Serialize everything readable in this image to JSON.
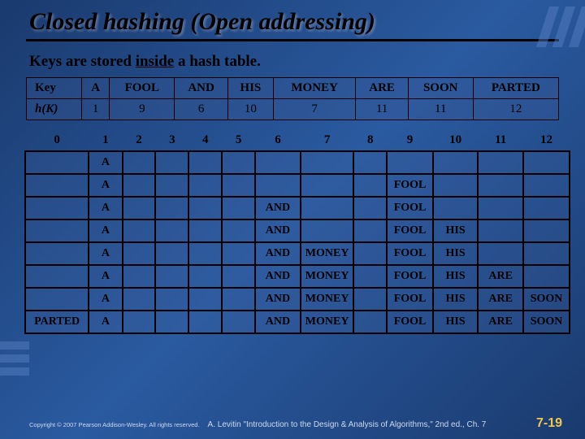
{
  "title": "Closed hashing (Open addressing)",
  "subtitle_pre": "Keys are stored ",
  "subtitle_u": "inside",
  "subtitle_post": " a hash table.",
  "hash": {
    "row_labels": [
      "Key",
      "h(K)"
    ],
    "keys": [
      "A",
      "FOOL",
      "AND",
      "HIS",
      "MONEY",
      "ARE",
      "SOON",
      "PARTED"
    ],
    "values": [
      "1",
      "9",
      "6",
      "10",
      "7",
      "11",
      "11",
      "12"
    ]
  },
  "insert": {
    "headers": [
      "0",
      "1",
      "2",
      "3",
      "4",
      "5",
      "6",
      "7",
      "8",
      "9",
      "10",
      "11",
      "12"
    ],
    "rows": [
      [
        "",
        "A",
        "",
        "",
        "",
        "",
        "",
        "",
        "",
        "",
        "",
        "",
        ""
      ],
      [
        "",
        "A",
        "",
        "",
        "",
        "",
        "",
        "",
        "",
        "FOOL",
        "",
        "",
        ""
      ],
      [
        "",
        "A",
        "",
        "",
        "",
        "",
        "AND",
        "",
        "",
        "FOOL",
        "",
        "",
        ""
      ],
      [
        "",
        "A",
        "",
        "",
        "",
        "",
        "AND",
        "",
        "",
        "FOOL",
        "HIS",
        "",
        ""
      ],
      [
        "",
        "A",
        "",
        "",
        "",
        "",
        "AND",
        "MONEY",
        "",
        "FOOL",
        "HIS",
        "",
        ""
      ],
      [
        "",
        "A",
        "",
        "",
        "",
        "",
        "AND",
        "MONEY",
        "",
        "FOOL",
        "HIS",
        "ARE",
        ""
      ],
      [
        "",
        "A",
        "",
        "",
        "",
        "",
        "AND",
        "MONEY",
        "",
        "FOOL",
        "HIS",
        "ARE",
        "SOON"
      ],
      [
        "PARTED",
        "A",
        "",
        "",
        "",
        "",
        "AND",
        "MONEY",
        "",
        "FOOL",
        "HIS",
        "ARE",
        "SOON"
      ]
    ]
  },
  "footer": {
    "copy": "Copyright © 2007 Pearson Addison-Wesley. All rights reserved.",
    "cite": "A. Levitin \"Introduction to the Design & Analysis of Algorithms,\" 2nd ed., Ch. 7",
    "page": "7-19"
  }
}
